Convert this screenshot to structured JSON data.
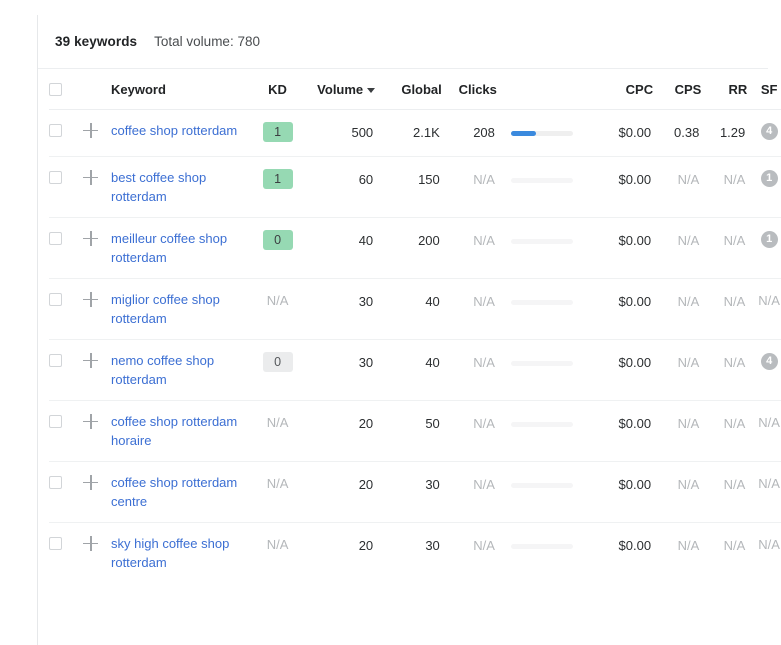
{
  "summary": {
    "keyword_count_label": "39 keywords",
    "total_volume_label": "Total volume: 780"
  },
  "colors": {
    "link": "#3c6fd3",
    "kd_easy_bg": "#96d9b3",
    "kd_gray_bg": "#ebeced",
    "clicks_bar_fill": "#3b8ade",
    "sf_badge_bg": "#b9bcbf",
    "muted_text": "#b4b7ba"
  },
  "table": {
    "headers": {
      "select_all": "",
      "keyword": "Keyword",
      "kd": "KD",
      "volume": "Volume",
      "global": "Global",
      "clicks": "Clicks",
      "bar": "",
      "cpc": "CPC",
      "cps": "CPS",
      "rr": "RR",
      "sf": "SF"
    },
    "sort": {
      "column": "Volume",
      "direction": "desc"
    },
    "rows": [
      {
        "keyword": "coffee shop rotterdam",
        "kd": "1",
        "kd_style": "green",
        "volume": "500",
        "global": "2.1K",
        "clicks": "208",
        "clicks_pct": 40,
        "cpc": "$0.00",
        "cps": "0.38",
        "rr": "1.29",
        "sf": "4",
        "sf_style": "badge"
      },
      {
        "keyword": "best coffee shop rotterdam",
        "kd": "1",
        "kd_style": "green",
        "volume": "60",
        "global": "150",
        "clicks": "N/A",
        "clicks_pct": 0,
        "cpc": "$0.00",
        "cps": "N/A",
        "rr": "N/A",
        "sf": "1",
        "sf_style": "badge"
      },
      {
        "keyword": "meilleur coffee shop rotterdam",
        "kd": "0",
        "kd_style": "green",
        "volume": "40",
        "global": "200",
        "clicks": "N/A",
        "clicks_pct": 0,
        "cpc": "$0.00",
        "cps": "N/A",
        "rr": "N/A",
        "sf": "1",
        "sf_style": "badge"
      },
      {
        "keyword": "miglior coffee shop rotterdam",
        "kd": "N/A",
        "kd_style": "na",
        "volume": "30",
        "global": "40",
        "clicks": "N/A",
        "clicks_pct": 0,
        "cpc": "$0.00",
        "cps": "N/A",
        "rr": "N/A",
        "sf": "N/A",
        "sf_style": "na"
      },
      {
        "keyword": "nemo coffee shop rotterdam",
        "kd": "0",
        "kd_style": "gray",
        "volume": "30",
        "global": "40",
        "clicks": "N/A",
        "clicks_pct": 0,
        "cpc": "$0.00",
        "cps": "N/A",
        "rr": "N/A",
        "sf": "4",
        "sf_style": "badge"
      },
      {
        "keyword": "coffee shop rotterdam horaire",
        "kd": "N/A",
        "kd_style": "na",
        "volume": "20",
        "global": "50",
        "clicks": "N/A",
        "clicks_pct": 0,
        "cpc": "$0.00",
        "cps": "N/A",
        "rr": "N/A",
        "sf": "N/A",
        "sf_style": "na"
      },
      {
        "keyword": "coffee shop rotterdam centre",
        "kd": "N/A",
        "kd_style": "na",
        "volume": "20",
        "global": "30",
        "clicks": "N/A",
        "clicks_pct": 0,
        "cpc": "$0.00",
        "cps": "N/A",
        "rr": "N/A",
        "sf": "N/A",
        "sf_style": "na"
      },
      {
        "keyword": "sky high coffee shop rotterdam",
        "kd": "N/A",
        "kd_style": "na",
        "volume": "20",
        "global": "30",
        "clicks": "N/A",
        "clicks_pct": 0,
        "cpc": "$0.00",
        "cps": "N/A",
        "rr": "N/A",
        "sf": "N/A",
        "sf_style": "na"
      }
    ]
  }
}
